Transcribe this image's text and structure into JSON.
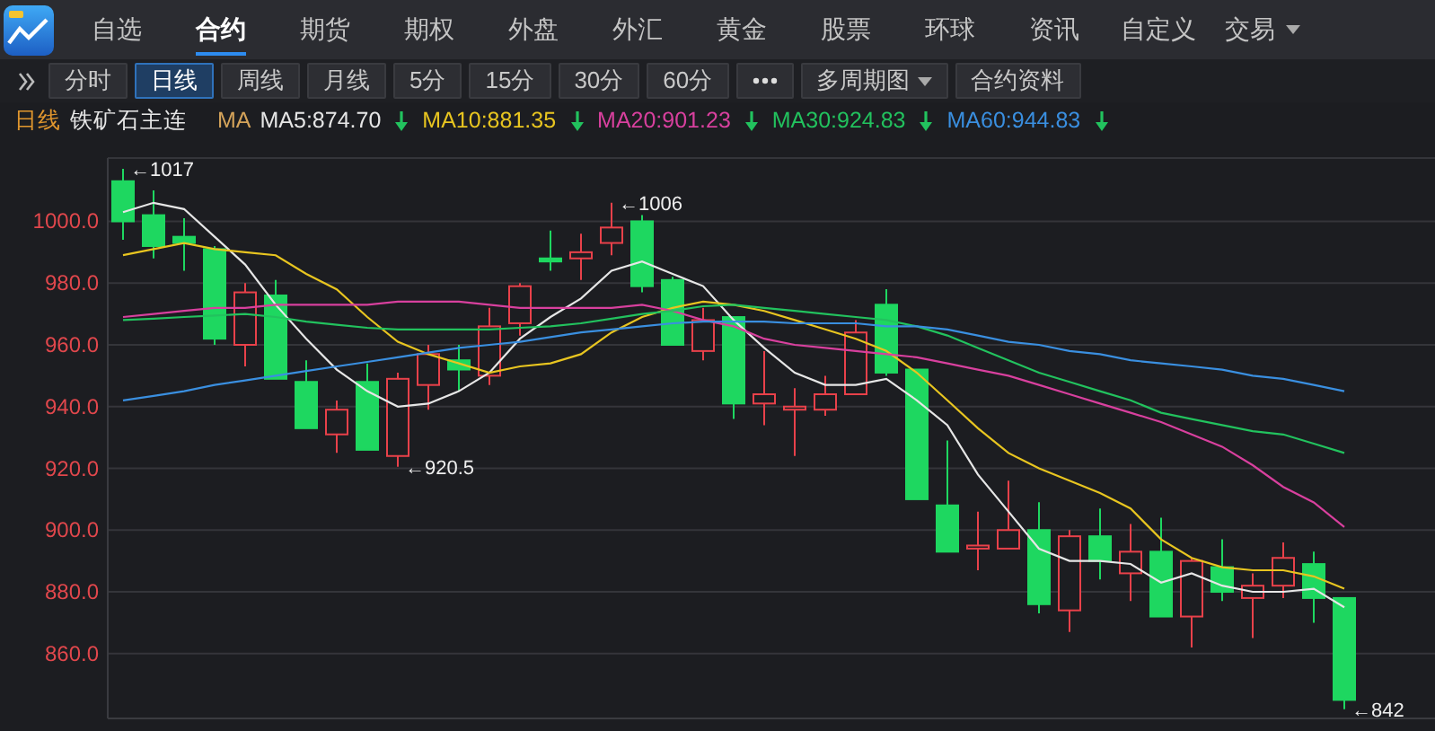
{
  "nav": {
    "tabs": [
      {
        "label": "自选",
        "selected": false,
        "has_menu": false
      },
      {
        "label": "合约",
        "selected": true,
        "has_menu": false
      },
      {
        "label": "期货",
        "selected": false,
        "has_menu": false
      },
      {
        "label": "期权",
        "selected": false,
        "has_menu": false
      },
      {
        "label": "外盘",
        "selected": false,
        "has_menu": false
      },
      {
        "label": "外汇",
        "selected": false,
        "has_menu": false
      },
      {
        "label": "黄金",
        "selected": false,
        "has_menu": false
      },
      {
        "label": "股票",
        "selected": false,
        "has_menu": false
      },
      {
        "label": "环球",
        "selected": false,
        "has_menu": false
      },
      {
        "label": "资讯",
        "selected": false,
        "has_menu": false
      },
      {
        "label": "自定义",
        "selected": false,
        "has_menu": false
      },
      {
        "label": "交易",
        "selected": false,
        "has_menu": true
      }
    ]
  },
  "toolbar": {
    "buttons": [
      {
        "kind": "period",
        "label": "分时",
        "selected": false
      },
      {
        "kind": "period",
        "label": "日线",
        "selected": true
      },
      {
        "kind": "period",
        "label": "周线",
        "selected": false
      },
      {
        "kind": "period",
        "label": "月线",
        "selected": false
      },
      {
        "kind": "period",
        "label": "5分",
        "selected": false
      },
      {
        "kind": "period",
        "label": "15分",
        "selected": false
      },
      {
        "kind": "period",
        "label": "30分",
        "selected": false
      },
      {
        "kind": "period",
        "label": "60分",
        "selected": false
      },
      {
        "kind": "more",
        "selected": false
      },
      {
        "kind": "dropdown",
        "label": "多周期图",
        "selected": false
      },
      {
        "kind": "plain",
        "label": "合约资料",
        "selected": false
      }
    ]
  },
  "legend": {
    "period": "日线",
    "symbol": "铁矿石主连",
    "ma_label": "MA",
    "averages": [
      {
        "value": ":874.70",
        "falling": true
      },
      {
        "value": ":881.35",
        "falling": true
      },
      {
        "value": ":901.23",
        "falling": true
      },
      {
        "value": ":924.83",
        "falling": true
      },
      {
        "value": ":944.83",
        "falling": true
      }
    ]
  },
  "chart": {
    "chart_data": {
      "type": "candlestick",
      "grid": true,
      "ylim": [
        839,
        1020.5
      ],
      "yticks": [
        {
          "value": 860,
          "label": "860.0"
        },
        {
          "value": 880,
          "label": "880.0"
        },
        {
          "value": 900,
          "label": "900.0"
        },
        {
          "value": 920,
          "label": "920.0"
        },
        {
          "value": 940,
          "label": "940.0"
        },
        {
          "value": 960,
          "label": "960.0"
        },
        {
          "value": 980,
          "label": "980.0"
        },
        {
          "value": 1000,
          "label": "1000.0"
        }
      ],
      "ohlc": [
        [
          1013,
          1017,
          994,
          1000
        ],
        [
          1002,
          1010,
          988,
          992
        ],
        [
          995,
          1001,
          984,
          993
        ],
        [
          991,
          992,
          960,
          962
        ],
        [
          960,
          980,
          953,
          977
        ],
        [
          976,
          981,
          949,
          949
        ],
        [
          948,
          955,
          933,
          933
        ],
        [
          931,
          942,
          925,
          939
        ],
        [
          948,
          954,
          926,
          926
        ],
        [
          924,
          951,
          920.5,
          949
        ],
        [
          947,
          960,
          939,
          957
        ],
        [
          955,
          960,
          945,
          952
        ],
        [
          950,
          972,
          947,
          966
        ],
        [
          967,
          980,
          963,
          979
        ],
        [
          988,
          997,
          984,
          987
        ],
        [
          988,
          996,
          981,
          990
        ],
        [
          993,
          1006,
          989,
          998
        ],
        [
          1000,
          1002,
          977,
          979
        ],
        [
          981,
          982,
          960,
          960
        ],
        [
          958,
          972,
          955,
          968
        ],
        [
          969,
          969,
          936,
          941
        ],
        [
          941,
          958,
          934,
          944
        ],
        [
          939,
          946,
          924,
          940
        ],
        [
          939,
          950,
          937,
          944
        ],
        [
          944,
          968,
          944,
          964
        ],
        [
          973,
          978,
          950,
          951
        ],
        [
          952,
          952,
          910,
          910
        ],
        [
          908,
          929,
          893,
          893
        ],
        [
          894,
          906,
          887,
          895
        ],
        [
          894,
          916,
          894,
          900
        ],
        [
          900,
          909,
          873,
          876
        ],
        [
          874,
          900,
          867,
          898
        ],
        [
          898,
          907,
          884,
          890
        ],
        [
          886,
          902,
          877,
          893
        ],
        [
          893,
          904,
          872,
          872
        ],
        [
          872,
          891,
          862,
          890
        ],
        [
          888,
          897,
          877,
          880
        ],
        [
          878,
          886,
          865,
          882
        ],
        [
          882,
          896,
          878,
          891
        ],
        [
          889,
          893,
          870,
          878
        ],
        [
          878,
          878,
          842,
          845
        ]
      ],
      "series": [
        {
          "name": "MA5",
          "type": "line",
          "color": "#e6e6e6",
          "values": [
            1003,
            1006,
            1004,
            995,
            986,
            973,
            962,
            952,
            945,
            940,
            941,
            945,
            951,
            962,
            969,
            975,
            984,
            987,
            983,
            979,
            968,
            959,
            951,
            947,
            947,
            949,
            942,
            934,
            918,
            906,
            894,
            890,
            890,
            889,
            883,
            886,
            882,
            880,
            880,
            881,
            875
          ]
        },
        {
          "name": "MA10",
          "type": "line",
          "color": "#e8c520",
          "values": [
            989,
            991,
            993,
            991,
            990,
            989,
            983,
            978,
            969,
            961,
            957,
            954,
            951,
            953,
            954,
            957,
            964,
            969,
            972,
            974,
            973,
            971,
            968,
            965,
            962,
            958,
            951,
            942,
            933,
            925,
            920,
            916,
            912,
            907,
            897,
            891,
            888,
            887,
            887,
            885,
            881
          ]
        },
        {
          "name": "MA20",
          "type": "line",
          "color": "#d8409e",
          "values": [
            969,
            970,
            971,
            972,
            972,
            973,
            973,
            973,
            973,
            974,
            974,
            974,
            973,
            972,
            972,
            972,
            972,
            973,
            971,
            968,
            966,
            962,
            960,
            959,
            958,
            957,
            956,
            954,
            952,
            950,
            947,
            944,
            941,
            938,
            935,
            931,
            927,
            921,
            914,
            909,
            901
          ]
        },
        {
          "name": "MA30",
          "type": "line",
          "color": "#22c25e",
          "values": [
            968,
            968.5,
            969,
            969.5,
            970,
            969,
            967.5,
            966.5,
            965.5,
            965,
            965,
            965,
            965,
            965.5,
            966,
            967,
            968.5,
            970,
            971,
            972.5,
            973,
            972,
            971,
            970,
            969,
            968,
            966,
            963,
            959,
            955,
            951,
            948,
            945,
            942,
            938,
            936,
            934,
            932,
            931,
            928,
            925
          ]
        },
        {
          "name": "MA60",
          "type": "line",
          "color": "#3a8fe0",
          "values": [
            942,
            943.5,
            945,
            947,
            948.5,
            950,
            951.5,
            953,
            954.5,
            956,
            957.5,
            959,
            960,
            961,
            962.5,
            964,
            965,
            966,
            967,
            967.5,
            967.5,
            967.5,
            967,
            967,
            967,
            966,
            966,
            965,
            963,
            961,
            960,
            958,
            957,
            955,
            954,
            953,
            952,
            950,
            949,
            947,
            945
          ]
        }
      ],
      "annotations": [
        "←1017",
        "←920.5",
        "←1006",
        "←842"
      ]
    }
  }
}
